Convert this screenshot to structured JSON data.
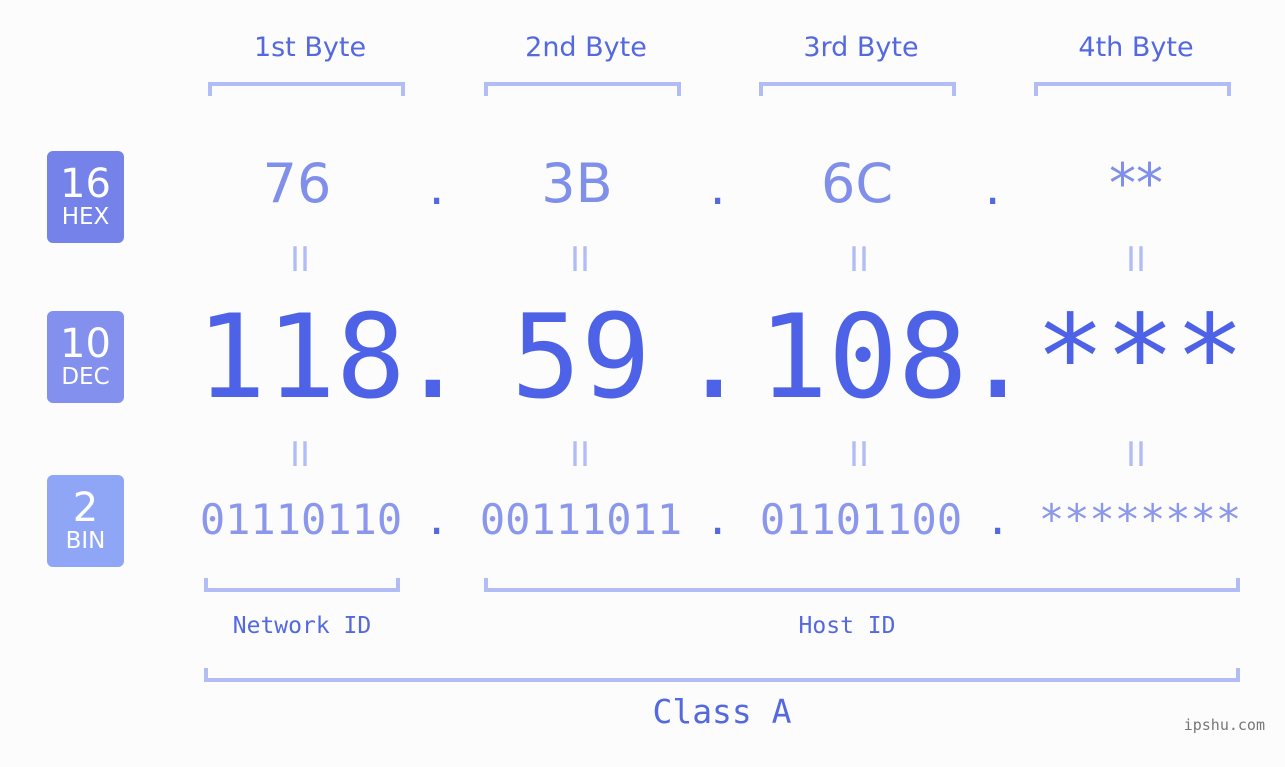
{
  "bytes": [
    {
      "title": "1st Byte",
      "hex": "76",
      "dec": "118",
      "bin": "01110110"
    },
    {
      "title": "2nd Byte",
      "hex": "3B",
      "dec": "59",
      "bin": "00111011"
    },
    {
      "title": "3rd Byte",
      "hex": "6C",
      "dec": "108",
      "bin": "01101100"
    },
    {
      "title": "4th Byte",
      "hex": "**",
      "dec": "***",
      "bin": "********"
    }
  ],
  "separator": ".",
  "equals": "II",
  "badges": {
    "hex": {
      "num": "16",
      "label": "HEX",
      "color": "#7482ea"
    },
    "dec": {
      "num": "10",
      "label": "DEC",
      "color": "#8390ee"
    },
    "bin": {
      "num": "2",
      "label": "BIN",
      "color": "#8fa6f7"
    }
  },
  "segments": {
    "network": "Network ID",
    "host": "Host ID",
    "class": "Class A"
  },
  "watermark": "ipshu.com"
}
